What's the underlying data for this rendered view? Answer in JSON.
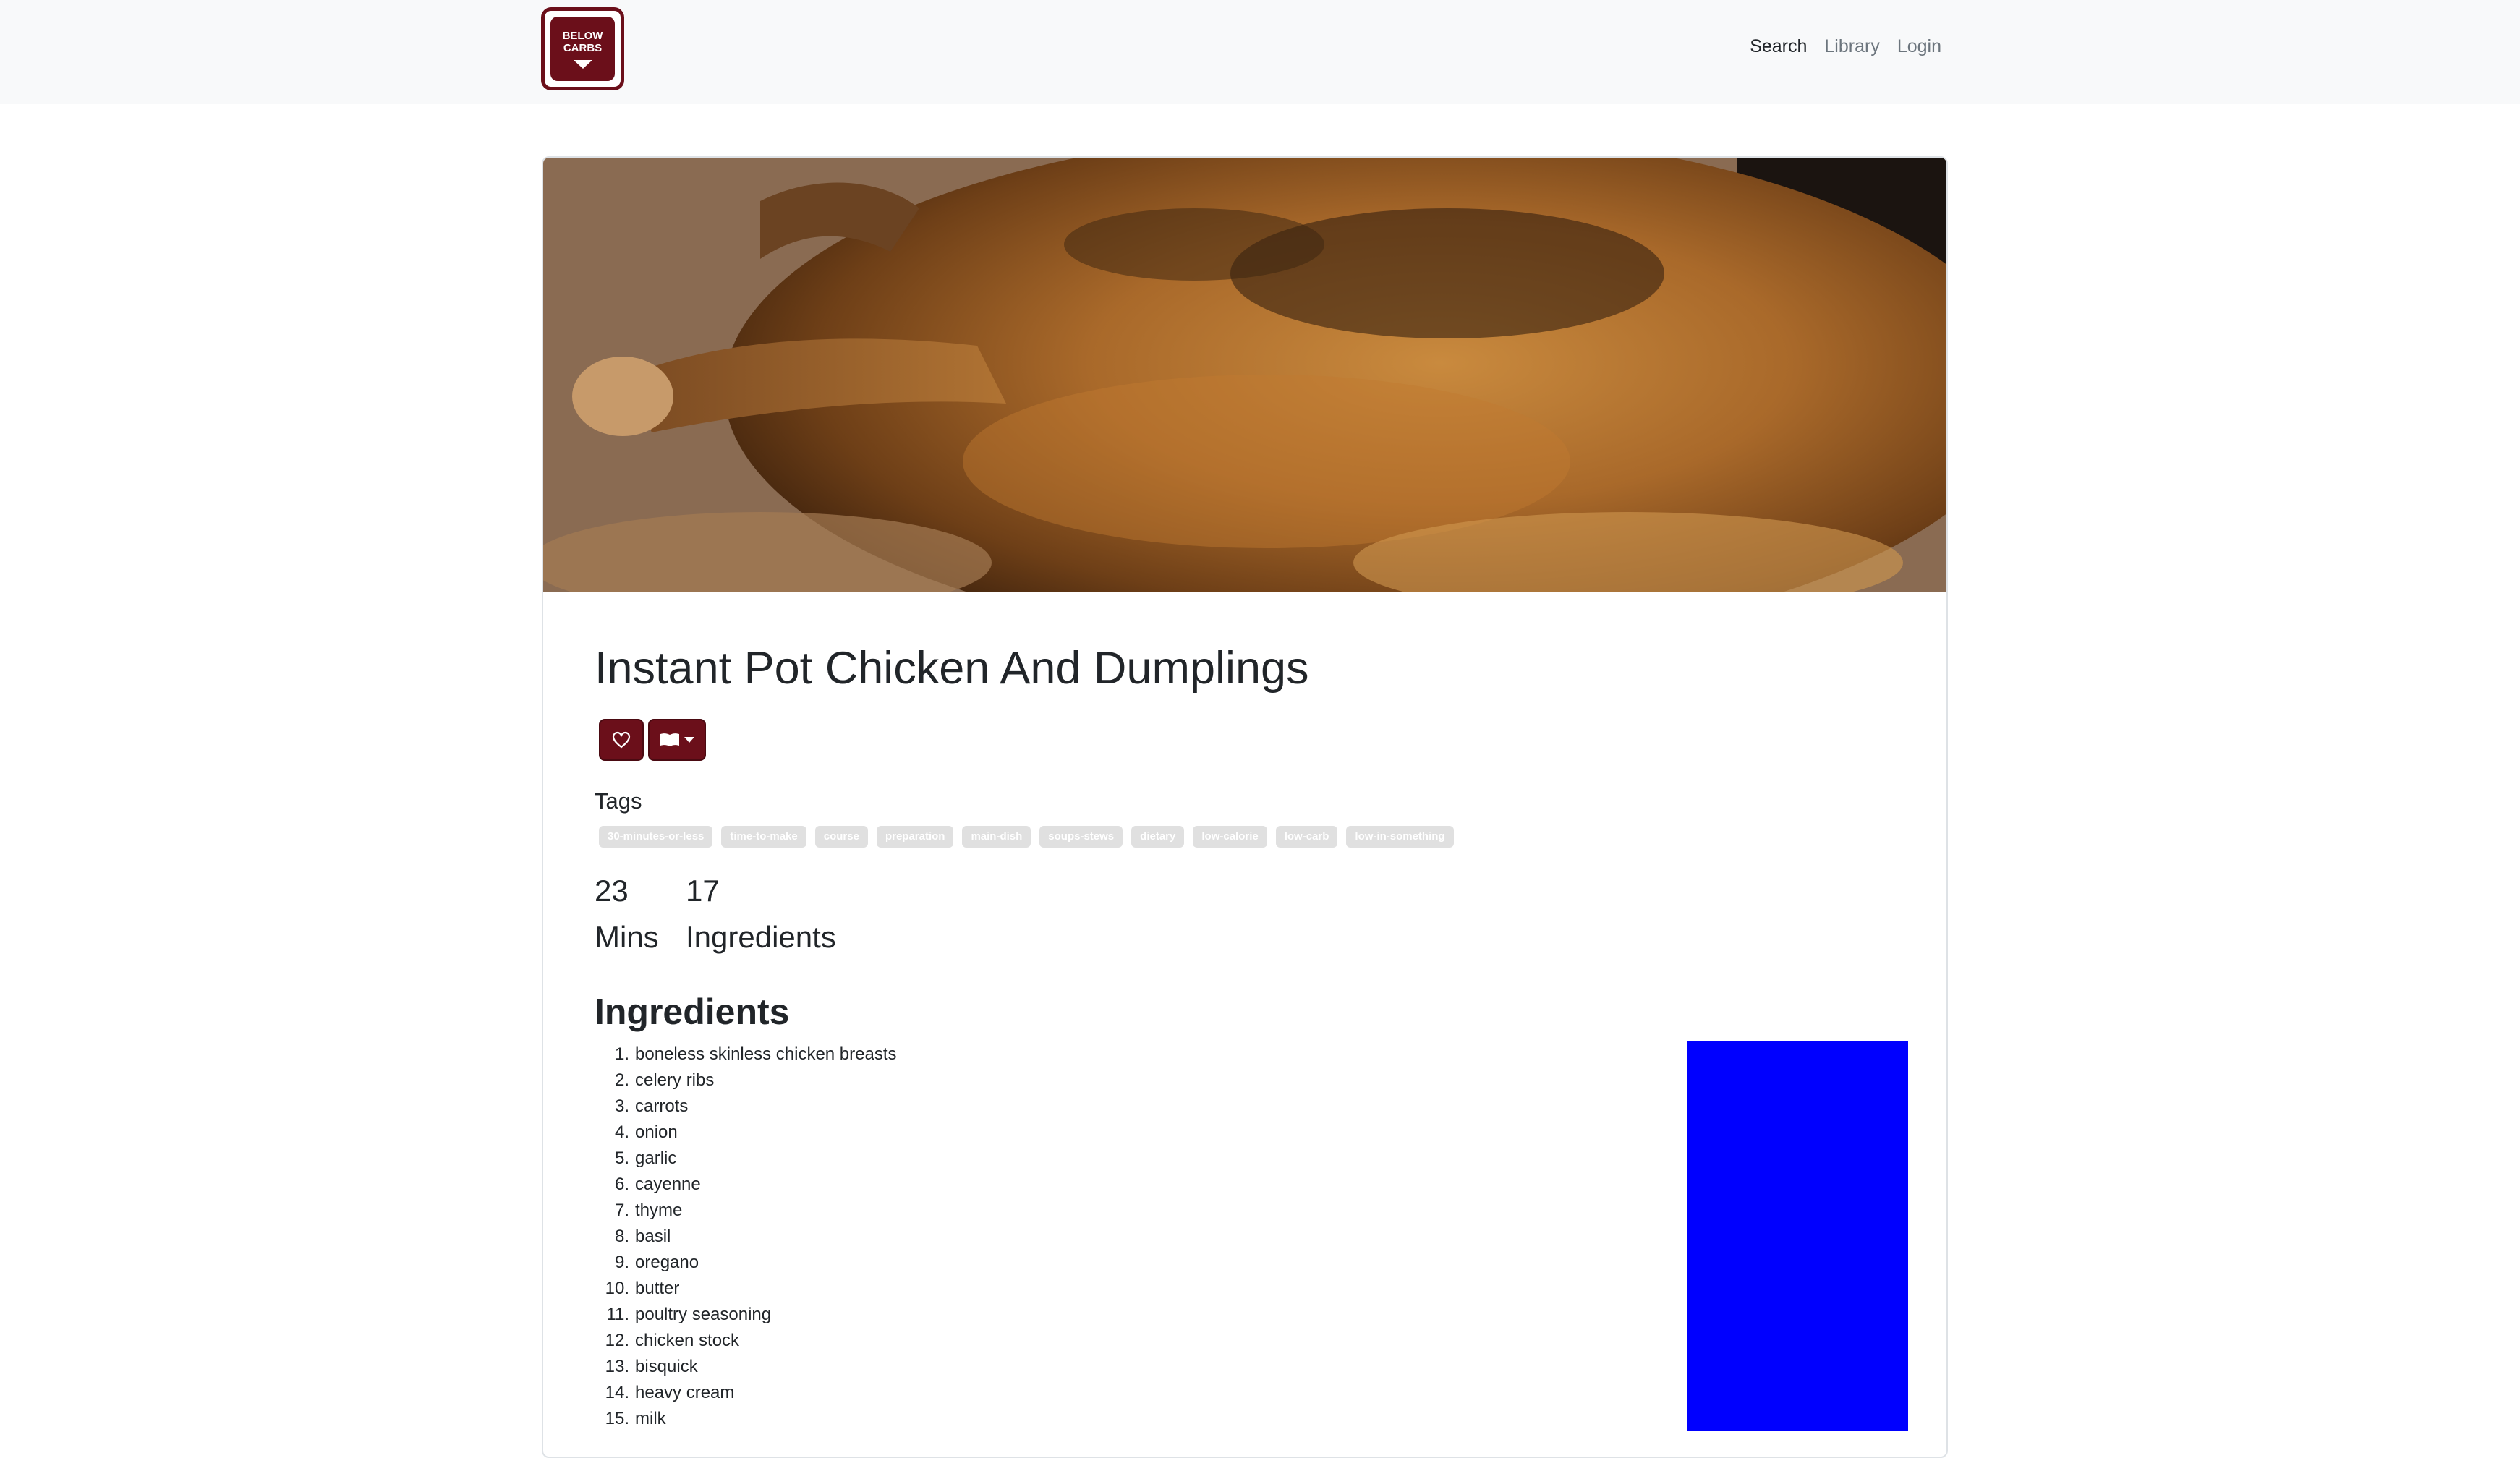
{
  "brand": {
    "logo_text_line1": "BELOW",
    "logo_text_line2": "CARBS"
  },
  "nav": {
    "links": [
      "Search",
      "Library",
      "Login"
    ]
  },
  "recipe": {
    "title": "Instant Pot Chicken And Dumplings",
    "tags_label": "Tags",
    "tags": [
      "30-minutes-or-less",
      "time-to-make",
      "course",
      "preparation",
      "main-dish",
      "soups-stews",
      "dietary",
      "low-calorie",
      "low-carb",
      "low-in-something"
    ],
    "time_value": "23",
    "time_unit": "Mins",
    "ingredient_count": "17",
    "ingredient_count_label": "Ingredients",
    "ingredients_heading": "Ingredients",
    "ingredients": [
      "boneless skinless chicken breasts",
      "celery ribs",
      "carrots",
      "onion",
      "garlic",
      "cayenne",
      "thyme",
      "basil",
      "oregano",
      "butter",
      "poultry seasoning",
      "chicken stock",
      "bisquick",
      "heavy cream",
      "milk"
    ]
  },
  "colors": {
    "brand": "#6b0f1a",
    "ad_placeholder": "#0000ff"
  },
  "icons": {
    "heart": "heart-icon",
    "book": "book-icon"
  }
}
